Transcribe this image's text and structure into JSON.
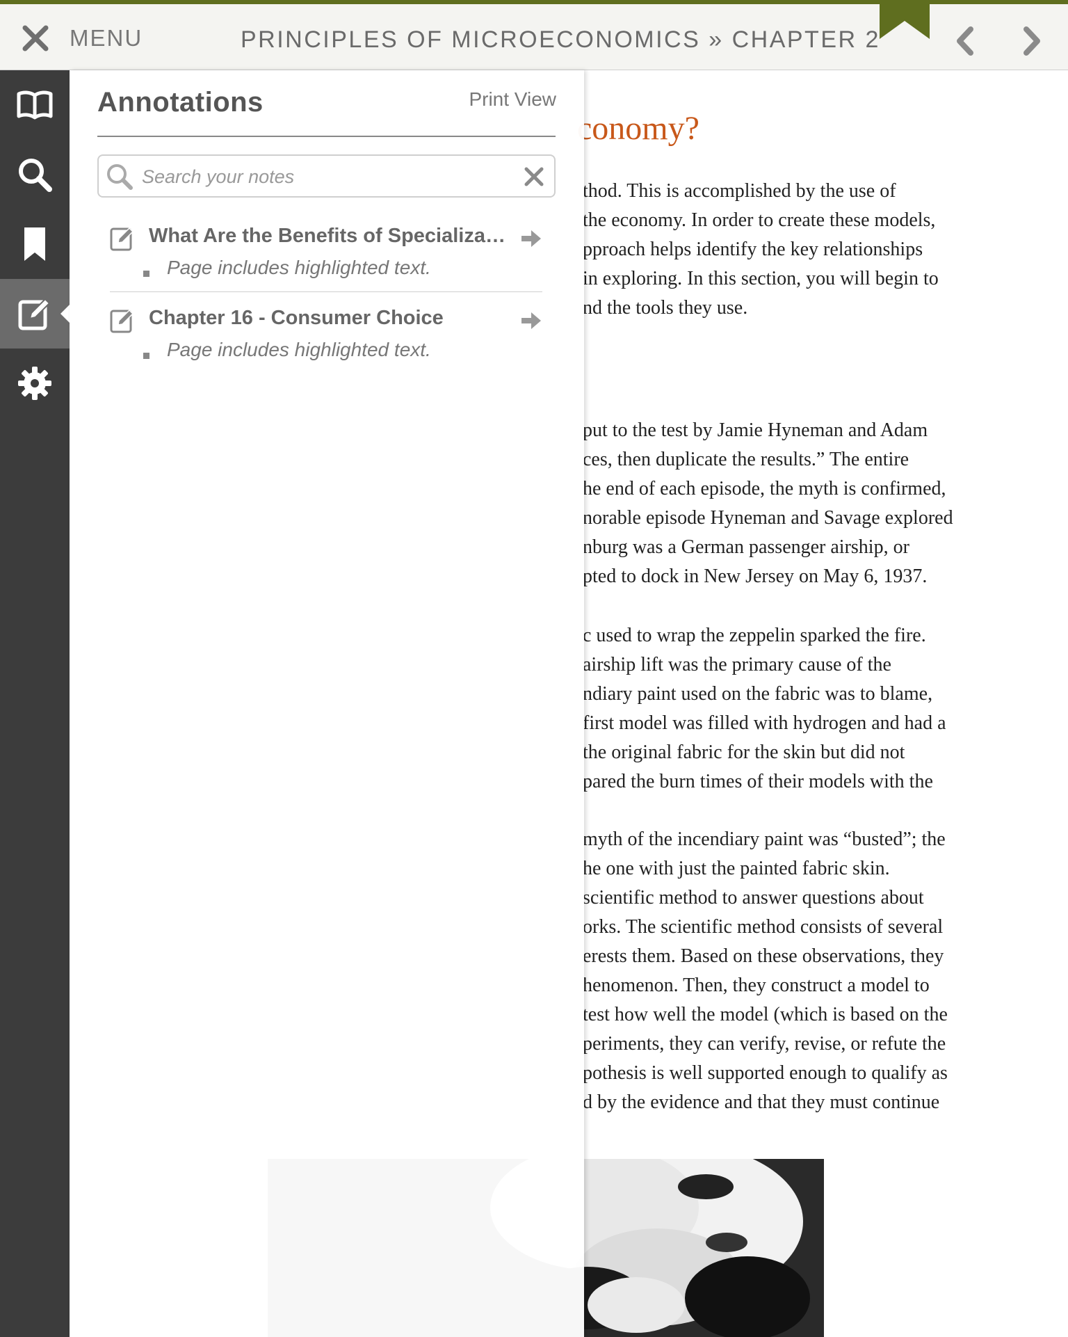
{
  "header": {
    "close_label": "×",
    "menu_label": "MENU",
    "book_title": "PRINCIPLES OF MICROECONOMICS » CHAPTER 2",
    "prev_icon": "chevron-left-icon",
    "next_icon": "chevron-right-icon",
    "accent_color": "#5f6e1f"
  },
  "sidebar": {
    "items": [
      {
        "icon": "book-icon",
        "active": false
      },
      {
        "icon": "search-icon",
        "active": false
      },
      {
        "icon": "bookmark-icon",
        "active": false
      },
      {
        "icon": "annotate-icon",
        "active": true
      },
      {
        "icon": "gear-icon",
        "active": false
      }
    ]
  },
  "annotations": {
    "title": "Annotations",
    "print_view": "Print View",
    "search_placeholder": "Search your notes",
    "notes": [
      {
        "title": "What Are the Benefits of Specialization and Trade?",
        "description": "Page includes highlighted text."
      },
      {
        "title": "Chapter 16 - Consumer Choice",
        "description": "Page includes highlighted text."
      }
    ]
  },
  "content": {
    "heading_fragment": "conomy?",
    "heading_color": "#c8581a",
    "paragraph_1": [
      "thod. This is accomplished by the use of",
      "the economy. In order to create these models,",
      "pproach helps identify the key relationships",
      "in exploring. In this section, you will begin to",
      "nd the tools they use."
    ],
    "paragraph_2": [
      "put to the test by Jamie Hyneman and Adam",
      "ces, then duplicate the results.” The entire",
      "he end of each episode, the myth is confirmed,",
      "norable episode Hyneman and Savage explored",
      "nburg was a German passenger airship, or",
      "pted to dock in New Jersey on May 6, 1937."
    ],
    "paragraph_3": [
      "c used to wrap the zeppelin sparked the fire.",
      "airship lift was the primary cause of the",
      "ndiary paint used on the fabric was to blame,",
      "first model was filled with hydrogen and had a",
      "the original fabric for the skin but did not",
      "pared the burn times of their models with the"
    ],
    "paragraph_4": [
      "myth of the incendiary paint was “busted”; the",
      "he one with just the painted fabric skin.",
      "scientific method to answer questions about",
      "orks. The scientific method consists of several",
      "erests them. Based on these observations, they",
      "henomenon. Then, they construct a model to",
      "test how well the model (which is based on the",
      "periments, they can verify, revise, or refute the",
      "pothesis is well supported enough to qualify as",
      "d by the evidence and that they must continue"
    ]
  }
}
